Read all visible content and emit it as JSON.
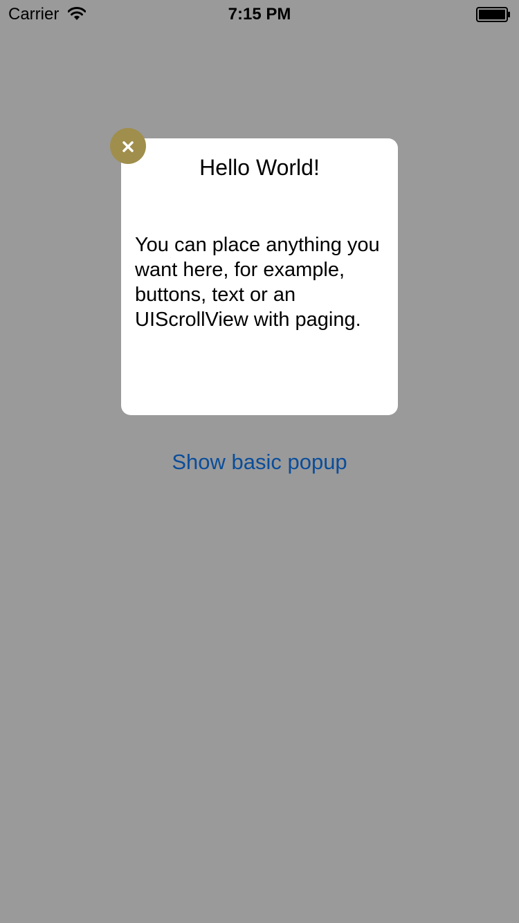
{
  "status_bar": {
    "carrier": "Carrier",
    "time": "7:15 PM",
    "wifi_icon": "wifi-icon",
    "battery_icon": "battery-icon"
  },
  "popup": {
    "title": "Hello World!",
    "body": "You can place anything you want here, for example, buttons, text or an UIScrollView with paging.",
    "close_icon": "close-icon",
    "close_button_color": "#a08e4c"
  },
  "main": {
    "show_popup_label": "Show basic popup",
    "link_color": "#0a4d9a"
  },
  "colors": {
    "background": "#9a9a9a",
    "popup_background": "#ffffff"
  }
}
